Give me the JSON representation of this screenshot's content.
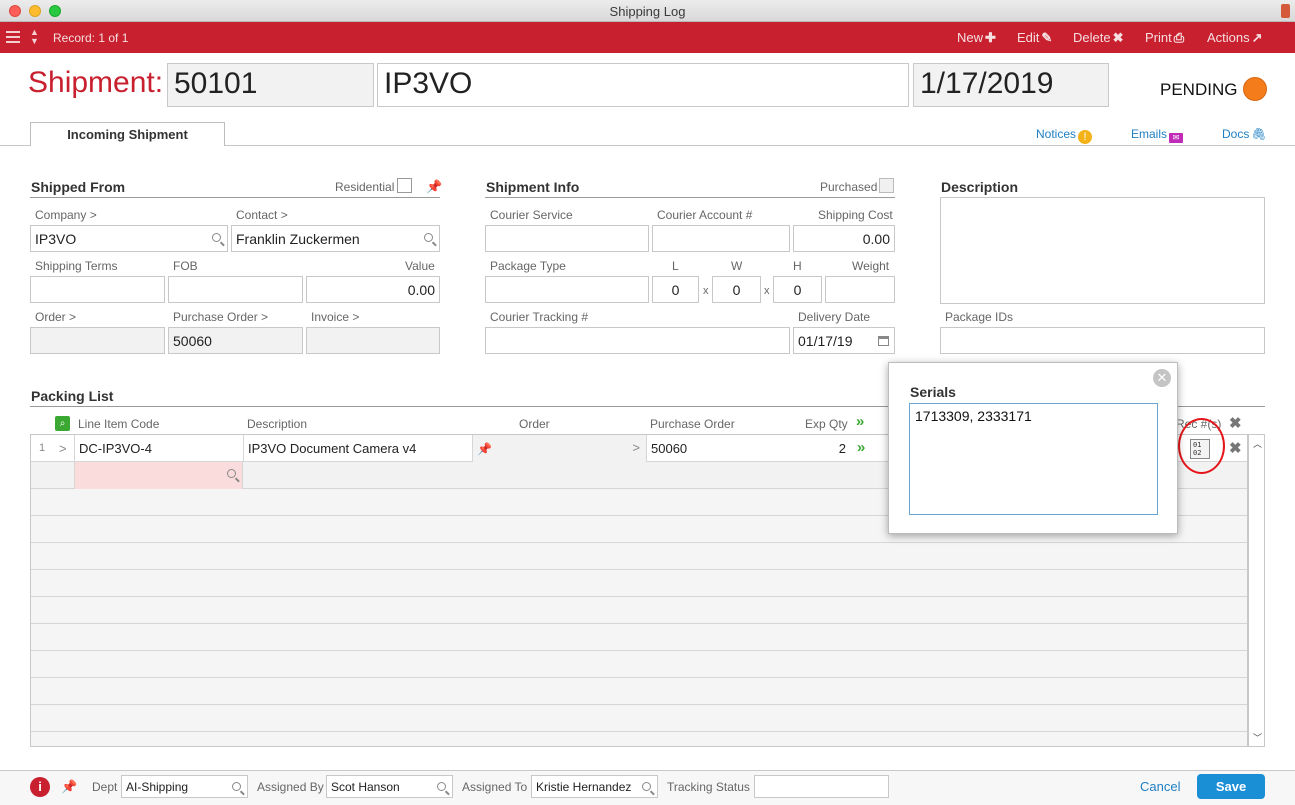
{
  "window": {
    "title": "Shipping Log"
  },
  "toolbar": {
    "record": "Record: 1 of 1",
    "new": "New",
    "edit": "Edit",
    "delete": "Delete",
    "print": "Print",
    "actions": "Actions"
  },
  "header": {
    "label": "Shipment:",
    "number": "50101",
    "name": "IP3VO",
    "date": "1/17/2019",
    "status": "PENDING",
    "status_color": "#f47c1a"
  },
  "tabs": {
    "active": "Incoming Shipment"
  },
  "links": {
    "notices": "Notices",
    "emails": "Emails",
    "docs": "Docs"
  },
  "shipped_from": {
    "title": "Shipped From",
    "residential_label": "Residential",
    "company_label": "Company >",
    "company": "IP3VO",
    "contact_label": "Contact >",
    "contact": "Franklin Zuckermen",
    "shipping_terms_label": "Shipping Terms",
    "shipping_terms": "",
    "fob_label": "FOB",
    "fob": "",
    "value_label": "Value",
    "value": "0.00",
    "order_label": "Order >",
    "order": "",
    "purchase_order_label": "Purchase Order >",
    "purchase_order": "50060",
    "invoice_label": "Invoice >",
    "invoice": ""
  },
  "shipment_info": {
    "title": "Shipment Info",
    "purchased_label": "Purchased",
    "courier_service_label": "Courier Service",
    "courier_service": "",
    "courier_account_label": "Courier Account #",
    "courier_account": "",
    "shipping_cost_label": "Shipping Cost",
    "shipping_cost": "0.00",
    "package_type_label": "Package Type",
    "package_type": "",
    "l_label": "L",
    "l": "0",
    "w_label": "W",
    "w": "0",
    "h_label": "H",
    "h": "0",
    "x_sep": "x",
    "weight_label": "Weight",
    "weight": "",
    "tracking_label": "Courier Tracking #",
    "tracking": "",
    "delivery_date_label": "Delivery Date",
    "delivery_date": "01/17/19"
  },
  "description": {
    "title": "Description",
    "text": "",
    "package_ids_label": "Package IDs",
    "package_ids": ""
  },
  "packing_list": {
    "title": "Packing List",
    "columns": {
      "line_item_code": "Line Item Code",
      "description": "Description",
      "order": "Order",
      "purchase_order": "Purchase Order",
      "exp_qty": "Exp Qty",
      "rec": "Rec #(s)"
    },
    "rows": [
      {
        "num": "1",
        "code": "DC-IP3VO-4",
        "description": "IP3VO Document Camera v4",
        "order": "",
        "purchase_order": "50060",
        "exp_qty": "2"
      }
    ]
  },
  "serials_popup": {
    "title": "Serials",
    "value": "1713309, 2333171",
    "icon_text_top": "01",
    "icon_text_bottom": "02"
  },
  "footer": {
    "dept_label": "Dept",
    "dept": "AI-Shipping",
    "assigned_by_label": "Assigned By",
    "assigned_by": "Scot Hanson",
    "assigned_to_label": "Assigned To",
    "assigned_to": "Kristie Hernandez",
    "tracking_status_label": "Tracking Status",
    "tracking_status": "",
    "cancel": "Cancel",
    "save": "Save"
  }
}
